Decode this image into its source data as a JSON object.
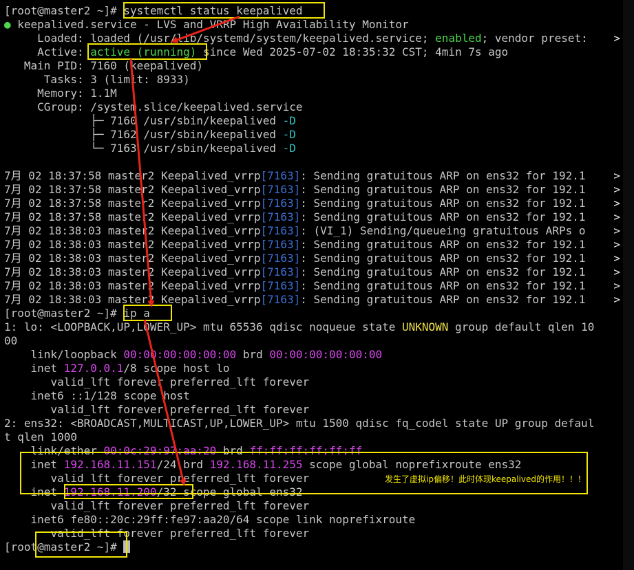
{
  "prompt": "[root@master2 ~]#",
  "cmd1": "systemctl status keepalived",
  "status": {
    "dot": "●",
    "service_line": "keepalived.service - LVS and VRRP High Availability Monitor",
    "loaded_label": "Loaded:",
    "loaded_text": "loaded (/usr/lib/systemd/system/keepalived.service;",
    "enabled": "enabled",
    "vendor": "; vendor preset:",
    "active_label": "Active:",
    "active_state": "active (running)",
    "since": "since Wed 2025-07-02 18:35:32 CST; 4min 7s ago",
    "mainpid_label": "Main PID:",
    "mainpid": "7160 (keepalived)",
    "tasks_label": "Tasks:",
    "tasks": "3 (limit: 8933)",
    "memory_label": "Memory:",
    "memory": "1.1M",
    "cgroup_label": "CGroup:",
    "cgroup": "/system.slice/keepalived.service",
    "procs": [
      {
        "tree": "├─",
        "pid": "7160",
        "path": "/usr/sbin/keepalived",
        "flag": "-D"
      },
      {
        "tree": "├─",
        "pid": "7162",
        "path": "/usr/sbin/keepalived",
        "flag": "-D"
      },
      {
        "tree": "└─",
        "pid": "7163",
        "path": "/usr/sbin/keepalived",
        "flag": "-D"
      }
    ]
  },
  "logs": [
    {
      "date": "7月 02 18:37:58",
      "host": "master2",
      "proc": "Keepalived_vrrp",
      "pid": "7163",
      "msg": ": Sending gratuitous ARP on ens32 for 192.1"
    },
    {
      "date": "7月 02 18:37:58",
      "host": "master2",
      "proc": "Keepalived_vrrp",
      "pid": "7163",
      "msg": ": Sending gratuitous ARP on ens32 for 192.1"
    },
    {
      "date": "7月 02 18:37:58",
      "host": "master2",
      "proc": "Keepalived_vrrp",
      "pid": "7163",
      "msg": ": Sending gratuitous ARP on ens32 for 192.1"
    },
    {
      "date": "7月 02 18:37:58",
      "host": "master2",
      "proc": "Keepalived_vrrp",
      "pid": "7163",
      "msg": ": Sending gratuitous ARP on ens32 for 192.1"
    },
    {
      "date": "7月 02 18:38:03",
      "host": "master2",
      "proc": "Keepalived_vrrp",
      "pid": "7163",
      "msg": ": (VI_1) Sending/queueing gratuitous ARPs o"
    },
    {
      "date": "7月 02 18:38:03",
      "host": "master2",
      "proc": "Keepalived_vrrp",
      "pid": "7163",
      "msg": ": Sending gratuitous ARP on ens32 for 192.1"
    },
    {
      "date": "7月 02 18:38:03",
      "host": "master2",
      "proc": "Keepalived_vrrp",
      "pid": "7163",
      "msg": ": Sending gratuitous ARP on ens32 for 192.1"
    },
    {
      "date": "7月 02 18:38:03",
      "host": "master2",
      "proc": "Keepalived_vrrp",
      "pid": "7163",
      "msg": ": Sending gratuitous ARP on ens32 for 192.1"
    },
    {
      "date": "7月 02 18:38:03",
      "host": "master2",
      "proc": "Keepalived_vrrp",
      "pid": "7163",
      "msg": ": Sending gratuitous ARP on ens32 for 192.1"
    },
    {
      "date": "7月 02 18:38:03",
      "host": "master2",
      "proc": "Keepalived_vrrp",
      "pid": "7163",
      "msg": ": Sending gratuitous ARP on ens32 for 192.1"
    }
  ],
  "continuation": ">",
  "cmd2": "ip a",
  "ipa": {
    "lo_head_a": "1: lo: <LOOPBACK,UP,LOWER_UP> mtu 65536 qdisc noqueue state ",
    "lo_state": "UNKNOWN",
    "lo_head_b": " group default qlen 10",
    "lo_wrap": "00",
    "lo_link_label": "link/loopback",
    "lo_mac": "00:00:00:00:00:00",
    "lo_brd_label": "brd",
    "lo_brd": "00:00:00:00:00:00",
    "lo_inet_label": "inet",
    "lo_inet": "127.0.0.1",
    "lo_inet_rest": "/8 scope host lo",
    "lft": "valid_lft forever preferred_lft forever",
    "lo_inet6": "inet6 ::1/128 scope host",
    "ens_head": "2: ens32: <BROADCAST,MULTICAST,UP,LOWER_UP> mtu 1500 qdisc fq_codel state UP group defaul",
    "ens_wrap": "t qlen 1000",
    "ens_link_label": "link/ether",
    "ens_mac": "00:0c:29:97:aa:20",
    "ens_brd_label": "brd",
    "ens_brd": "ff:ff:ff:ff:ff:ff",
    "ens_inet_label": "inet",
    "ens_ip1": "192.168.11.151",
    "ens_ip1_rest_a": "/24 brd ",
    "ens_ip1_brd": "192.168.11.255",
    "ens_ip1_rest_b": " scope global noprefixroute ens32",
    "ens_vip": "192.168.11.200",
    "ens_vip_rest": "/32 scope global ens32",
    "ens_inet6": "inet6 fe80::20c:29ff:fe97:aa20/64 scope link noprefixroute"
  },
  "annotation": "发生了虚拟ip偏移！此时体现keepalived的作用！！！",
  "colors": {
    "background": "#000000",
    "text": "#c8c8c8",
    "green": "#4dd84d",
    "yellow": "#f0e14a",
    "magenta": "#d946ef",
    "blue": "#3b6fd8",
    "highlight_box": "#f2e600",
    "arrow": "#e8231a"
  }
}
